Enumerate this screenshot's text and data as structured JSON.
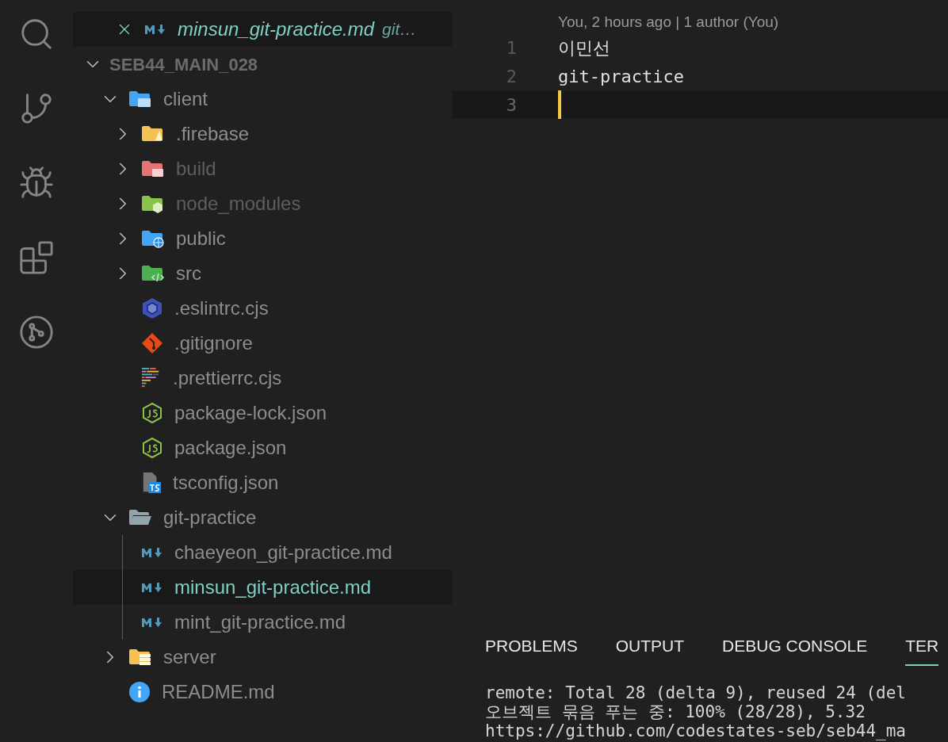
{
  "activity_bar": [
    {
      "kind": "search"
    },
    {
      "kind": "source-control"
    },
    {
      "kind": "run-debug"
    },
    {
      "kind": "extensions"
    },
    {
      "kind": "git-graph"
    }
  ],
  "open_editors": [
    {
      "name": "minsun_git-practice.md",
      "description": "git…",
      "selected": true
    }
  ],
  "explorer": {
    "root": {
      "label": "SEB44_MAIN_028",
      "expanded": true,
      "children": [
        {
          "label": "client",
          "kind": "folder",
          "expanded": true,
          "ignored": false,
          "selected": false,
          "children": [
            {
              "label": ".firebase",
              "kind": "folder",
              "expanded": false,
              "ignored": false,
              "selected": false
            },
            {
              "label": "build",
              "kind": "folder",
              "expanded": false,
              "ignored": true,
              "selected": false
            },
            {
              "label": "node_modules",
              "kind": "folder",
              "expanded": false,
              "ignored": true,
              "selected": false
            },
            {
              "label": "public",
              "kind": "folder",
              "expanded": false,
              "ignored": false,
              "selected": false
            },
            {
              "label": "src",
              "kind": "folder",
              "expanded": false,
              "ignored": false,
              "selected": false
            },
            {
              "label": ".eslintrc.cjs",
              "kind": "file",
              "ignored": false,
              "selected": false
            },
            {
              "label": ".gitignore",
              "kind": "file",
              "ignored": false,
              "selected": false
            },
            {
              "label": ".prettierrc.cjs",
              "kind": "file",
              "ignored": false,
              "selected": false
            },
            {
              "label": "package-lock.json",
              "kind": "file",
              "ignored": false,
              "selected": false
            },
            {
              "label": "package.json",
              "kind": "file",
              "ignored": false,
              "selected": false
            },
            {
              "label": "tsconfig.json",
              "kind": "file",
              "ignored": false,
              "selected": false
            }
          ]
        },
        {
          "label": "git-practice",
          "kind": "folder",
          "expanded": true,
          "ignored": false,
          "selected": false,
          "children": [
            {
              "label": "chaeyeon_git-practice.md",
              "kind": "file",
              "ignored": false,
              "selected": false
            },
            {
              "label": "minsun_git-practice.md",
              "kind": "file",
              "ignored": false,
              "selected": true
            },
            {
              "label": "mint_git-practice.md",
              "kind": "file",
              "ignored": false,
              "selected": false
            }
          ]
        },
        {
          "label": "server",
          "kind": "folder",
          "expanded": false,
          "ignored": false,
          "selected": false
        },
        {
          "label": "README.md",
          "kind": "file",
          "ignored": false,
          "selected": false
        }
      ]
    }
  },
  "editor": {
    "blame": "You, 2 hours ago | 1 author (You)",
    "lines": [
      {
        "number": "1",
        "text": "이민선",
        "current": false
      },
      {
        "number": "2",
        "text": "git-practice",
        "current": false
      },
      {
        "number": "3",
        "current": true
      }
    ]
  },
  "panel": {
    "tabs": [
      {
        "label": "PROBLEMS",
        "selected": false
      },
      {
        "label": "OUTPUT",
        "selected": false
      },
      {
        "label": "DEBUG CONSOLE",
        "selected": false
      },
      {
        "label": "TER",
        "selected": true
      }
    ],
    "terminal_lines": [
      "remote: Total 28 (delta 9), reused 24 (del",
      "오브젝트 묶음 푸는 중: 100% (28/28), 5.32",
      "https://github.com/codestates-seb/seb44_ma"
    ]
  }
}
